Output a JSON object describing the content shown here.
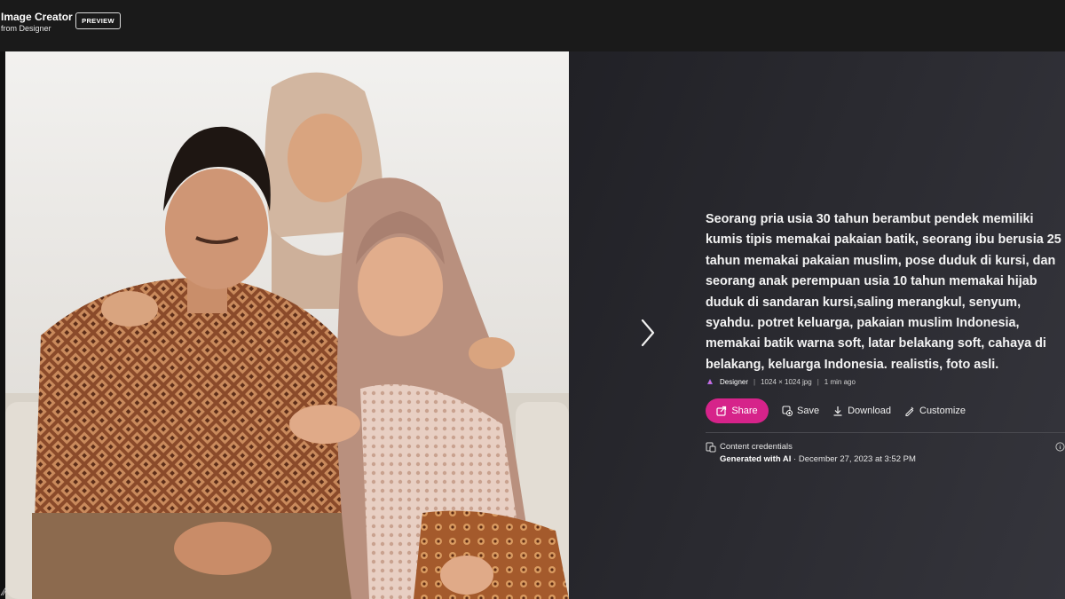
{
  "header": {
    "title": "Image Creator",
    "subtitle": "from Designer",
    "preview_label": "PREVIEW"
  },
  "image": {
    "alt_icon": "image-icon"
  },
  "nav": {
    "next_icon": "chevron-right-icon"
  },
  "details": {
    "prompt": "Seorang pria usia 30 tahun berambut pendek memiliki kumis tipis memakai pakaian batik, seorang ibu berusia 25 tahun memakai pakaian muslim, pose duduk di kursi, dan seorang anak perempuan usia 10 tahun memakai hijab duduk di sandaran kursi,saling merangkul, senyum, syahdu. potret keluarga, pakaian muslim Indonesia, memakai batik warna soft, latar belakang soft, cahaya di belakang, keluarga Indonesia. realistis, foto asli.",
    "meta": {
      "source": "Designer",
      "size": "1024 × 1024 jpg",
      "time": "1 min ago"
    },
    "actions": {
      "share": "Share",
      "save": "Save",
      "download": "Download",
      "customize": "Customize"
    },
    "credentials": {
      "label": "Content credentials",
      "generated": "Generated with AI",
      "date": " · December 27, 2023 at 3:52 PM"
    }
  },
  "colors": {
    "accent": "#d6238a",
    "header_bg": "#1a1a1a"
  }
}
